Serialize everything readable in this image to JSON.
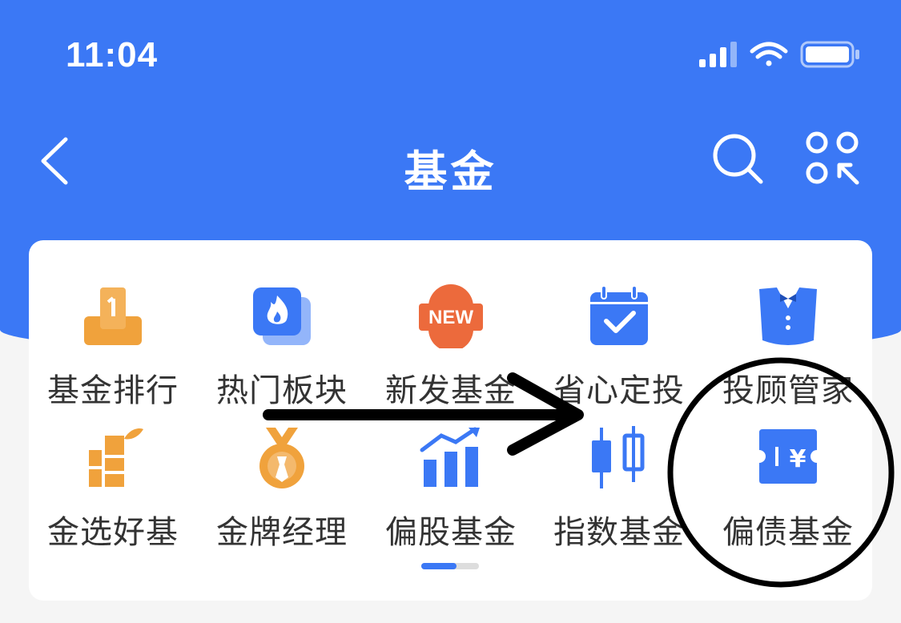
{
  "status_bar": {
    "time": "11:04"
  },
  "header": {
    "title": "基金"
  },
  "menu": {
    "items": [
      {
        "label": "基金排行",
        "icon": "ranking-podium-icon"
      },
      {
        "label": "热门板块",
        "icon": "hot-sector-flame-icon"
      },
      {
        "label": "新发基金",
        "icon": "new-badge-icon",
        "badge_text": "NEW"
      },
      {
        "label": "省心定投",
        "icon": "calendar-check-icon"
      },
      {
        "label": "投顾管家",
        "icon": "butler-tuxedo-icon"
      },
      {
        "label": "金选好基",
        "icon": "bamboo-icon"
      },
      {
        "label": "金牌经理",
        "icon": "gold-medal-icon"
      },
      {
        "label": "偏股基金",
        "icon": "bar-chart-trend-icon"
      },
      {
        "label": "指数基金",
        "icon": "candlestick-icon"
      },
      {
        "label": "偏债基金",
        "icon": "bond-ticket-yen-icon",
        "icon_text": "¥"
      }
    ]
  },
  "pager": {
    "pages": 2,
    "current": 1
  },
  "colors": {
    "primary": "#3b78f5",
    "orange": "#f0a23c",
    "red_orange": "#ec6a3c",
    "text": "#333333"
  }
}
